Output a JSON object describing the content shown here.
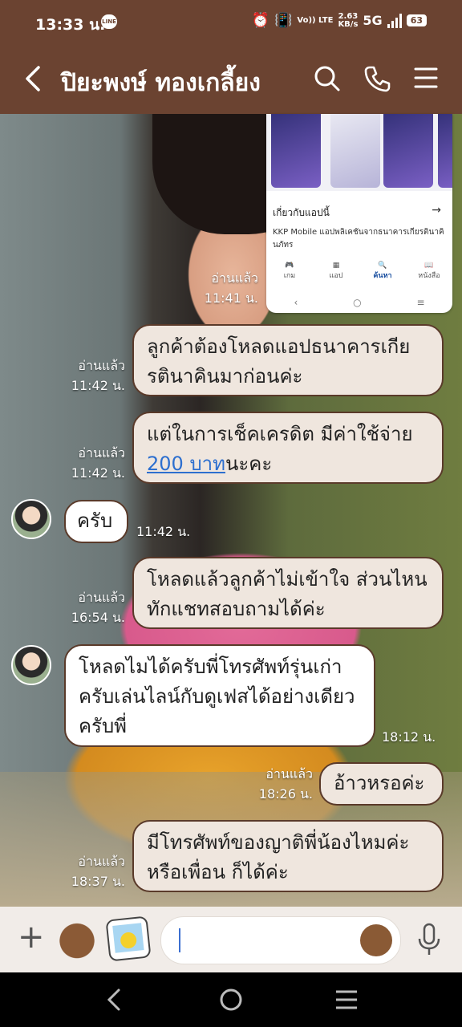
{
  "status_bar": {
    "time": "13:33 น.",
    "line_badge": "LINE",
    "volte": "Vo)) LTE",
    "speed_value": "2.63",
    "speed_unit": "KB/s",
    "network": "5G",
    "battery": "63"
  },
  "header": {
    "contact_name": "ปิยะพงษ์ ทองเกลี้ยง"
  },
  "shared_screenshot": {
    "about_label": "เกี่ยวกับแอปนี้",
    "description": "KKP Mobile แอปพลิเคชันจากธนาคารเกียรตินาคินภัทร",
    "nav": [
      "เกม",
      "แอป",
      "ค้นหา",
      "หนังสือ"
    ],
    "read": "อ่านแล้ว",
    "time": "11:41 น."
  },
  "messages": [
    {
      "side": "me",
      "text": "ลูกค้าต้องโหลดแอปธนาคารเกียรตินาคินมาก่อนค่ะ",
      "read": "อ่านแล้ว",
      "time": "11:42 น."
    },
    {
      "side": "me",
      "text_before": "แต่ในการเช็คเครดิต มีค่าใช้จ่าย ",
      "link": "200 บาท",
      "text_after": "นะคะ",
      "read": "อ่านแล้ว",
      "time": "11:42 น."
    },
    {
      "side": "them",
      "text": "ครับ",
      "time": "11:42 น."
    },
    {
      "side": "me",
      "text": "โหลดแล้วลูกค้าไม่เข้าใจ ส่วนไหนทักแชทสอบถามได้ค่ะ",
      "read": "อ่านแล้ว",
      "time": "16:54 น."
    },
    {
      "side": "them",
      "text": "โหลดไมได้ครับพี่โทรศัพท์รุ่นเก่าครับเล่นไลน์กับดูเฟสได้อย่างเดียวครับพี่",
      "time": "18:12 น."
    },
    {
      "side": "me",
      "text": "อ้าวหรอค่ะ",
      "read": "อ่านแล้ว",
      "time": "18:26 น."
    },
    {
      "side": "me",
      "text": "มีโทรศัพท์ของญาติพี่น้องไหมค่ะหรือเพื่อน ก็ได้ค่ะ",
      "read": "อ่านแล้ว",
      "time": "18:37 น."
    }
  ],
  "colors": {
    "header_bg": "#6b4331",
    "bubble_me": "#efe6de",
    "bubble_them": "#ffffff",
    "link": "#2d6fcf"
  },
  "icons": {
    "back": "chevron-left-icon",
    "search": "search-icon",
    "call": "phone-icon",
    "menu": "menu-icon",
    "plus": "plus-icon",
    "sticker": "sticker-icon",
    "emoji": "emoji-icon",
    "mic": "mic-icon"
  }
}
